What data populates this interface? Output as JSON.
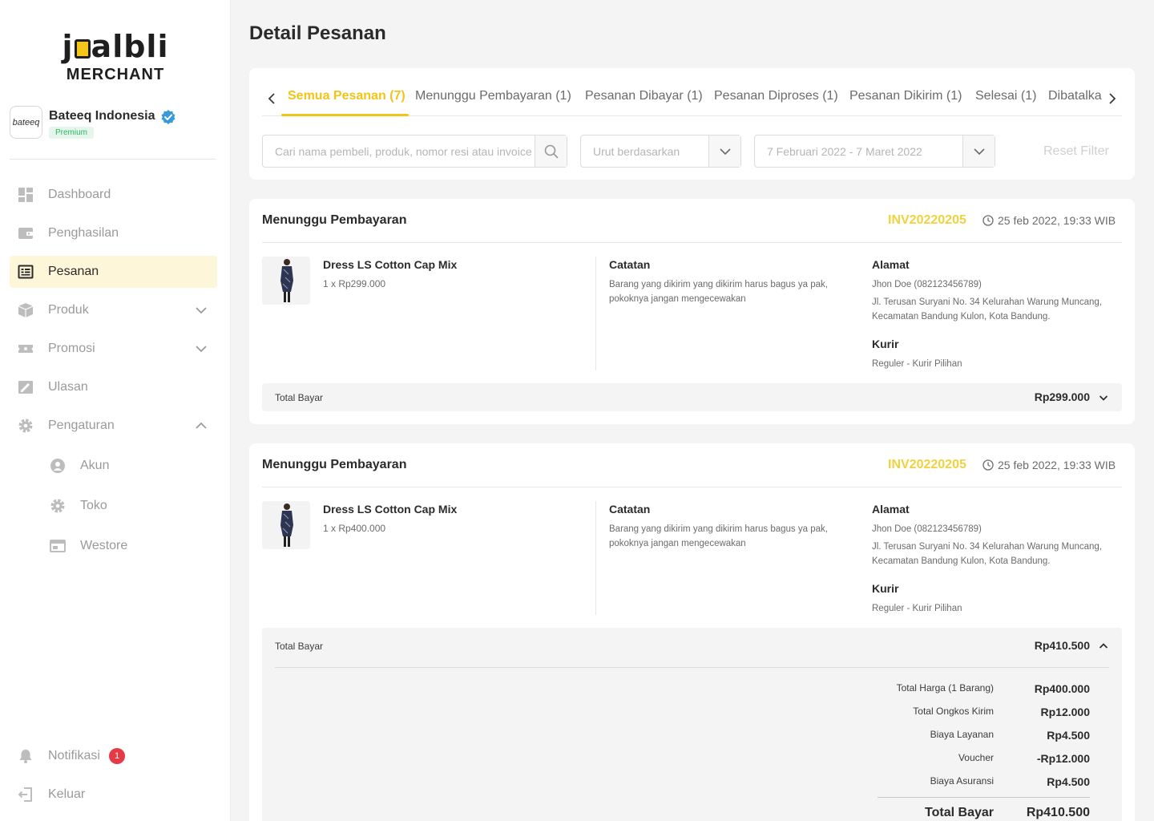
{
  "brand": {
    "logo_text": "jualbli",
    "logo_sub": "MERCHANT"
  },
  "store": {
    "avatar_text": "bateeq",
    "name": "Bateeq Indonesia",
    "badge": "Premium"
  },
  "sidebar": {
    "items": [
      {
        "label": "Dashboard",
        "icon": "dashboard-icon"
      },
      {
        "label": "Penghasilan",
        "icon": "wallet-icon"
      },
      {
        "label": "Pesanan",
        "icon": "order-list-icon",
        "active": true
      },
      {
        "label": "Produk",
        "icon": "box-icon"
      },
      {
        "label": "Promosi",
        "icon": "ticket-icon"
      },
      {
        "label": "Ulasan",
        "icon": "review-icon"
      },
      {
        "label": "Pengaturan",
        "icon": "gear-icon"
      }
    ],
    "sub_items": [
      {
        "label": "Akun",
        "icon": "user-circle-icon"
      },
      {
        "label": "Toko",
        "icon": "gear-icon"
      },
      {
        "label": "Westore",
        "icon": "browser-icon"
      }
    ],
    "notifikasi": {
      "label": "Notifikasi",
      "count": "1"
    },
    "keluar": {
      "label": "Keluar"
    }
  },
  "page": {
    "title": "Detail Pesanan"
  },
  "tabs": [
    "Semua Pesanan (7)",
    "Menunggu Pembayaran (1)",
    "Pesanan Dibayar (1)",
    "Pesanan Diproses (1)",
    "Pesanan Dikirim (1)",
    "Selesai (1)",
    "Dibatalka"
  ],
  "filters": {
    "search_placeholder": "Cari nama pembeli, produk, nomor resi atau invoice",
    "sort_placeholder": "Urut berdasarkan",
    "date_range": "7 Februari 2022 - 7 Maret 2022",
    "reset_label": "Reset Filter"
  },
  "orders": [
    {
      "status": "Menunggu Pembayaran",
      "invoice": "INV20220205",
      "datetime": "25 feb 2022, 19:33 WIB",
      "product_name": "Dress LS Cotton Cap Mix",
      "quantity_price": "1 x Rp299.000",
      "note_title": "Catatan",
      "note_lines": [
        "Barang yang dikirim yang dikirim harus bagus ya pak,",
        "pokoknya jangan mengecewakan"
      ],
      "address_title": "Alamat",
      "recipient": "Jhon Doe (082123456789)",
      "address_lines": [
        "Jl. Terusan Suryani No. 34 Kelurahan Warung Muncang,",
        "Kecamatan Bandung Kulon, Kota Bandung."
      ],
      "courier_title": "Kurir",
      "courier": "Reguler - Kurir Pilihan",
      "total_label": "Total Bayar",
      "total_value": "Rp299.000"
    },
    {
      "status": "Menunggu Pembayaran",
      "invoice": "INV20220205",
      "datetime": "25 feb 2022, 19:33 WIB",
      "product_name": "Dress LS Cotton Cap Mix",
      "quantity_price": "1 x Rp400.000",
      "note_title": "Catatan",
      "note_lines": [
        "Barang yang dikirim yang dikirim harus bagus ya pak,",
        "pokoknya jangan mengecewakan"
      ],
      "address_title": "Alamat",
      "recipient": "Jhon Doe (082123456789)",
      "address_lines": [
        "Jl. Terusan Suryani No. 34 Kelurahan Warung Muncang,",
        "Kecamatan Bandung Kulon, Kota Bandung."
      ],
      "courier_title": "Kurir",
      "courier": "Reguler - Kurir Pilihan",
      "total_label": "Total Bayar",
      "total_value": "Rp410.500",
      "breakdown": [
        {
          "label": "Total Harga (1 Barang)",
          "value": "Rp400.000"
        },
        {
          "label": "Total Ongkos Kirim",
          "value": "Rp12.000"
        },
        {
          "label": "Biaya Layanan",
          "value": "Rp4.500"
        },
        {
          "label": "Voucher",
          "value": "-Rp12.000"
        },
        {
          "label": "Biaya Asuransi",
          "value": "Rp4.500"
        }
      ],
      "grand_total_label": "Total Bayar",
      "grand_total_value": "Rp410.500"
    }
  ],
  "colors": {
    "accent": "#f2c417",
    "active_bg": "#fdf6d8",
    "badge_red": "#e63946",
    "verified_blue": "#3a9ad9"
  }
}
